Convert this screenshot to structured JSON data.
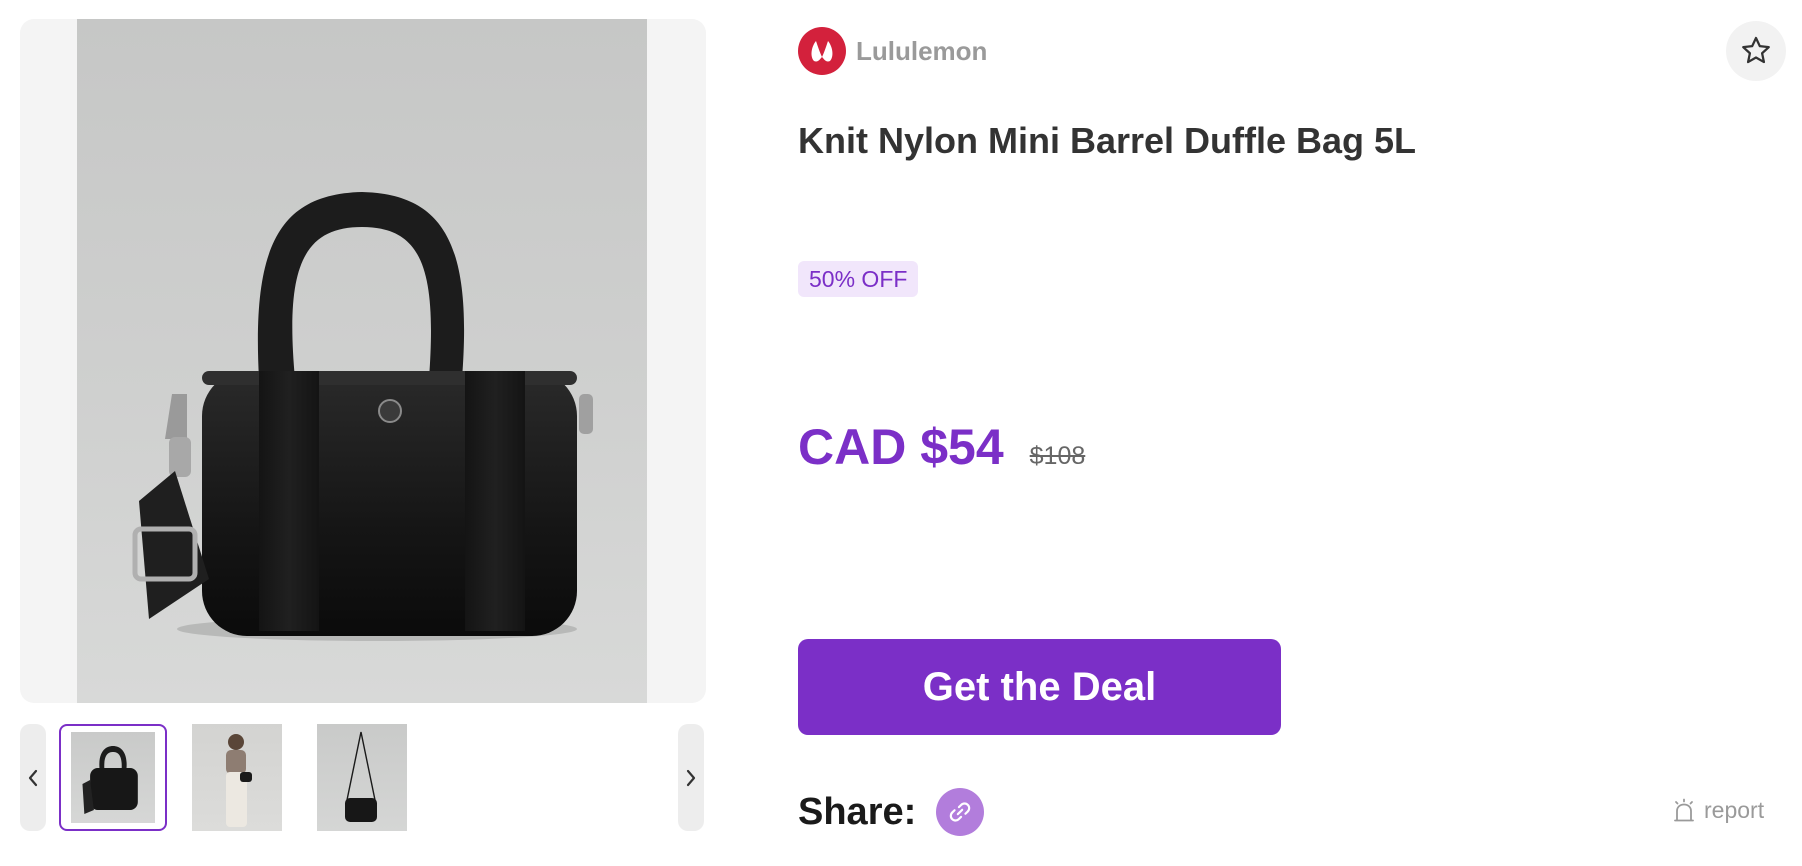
{
  "product": {
    "brand": "Lululemon",
    "title": "Knit Nylon Mini Barrel Duffle Bag 5L",
    "discount_badge": "50% OFF",
    "price_current": "CAD $54",
    "price_original": "$108"
  },
  "actions": {
    "deal_button_label": "Get the Deal",
    "share_label": "Share:",
    "report_label": "report"
  },
  "gallery": {
    "thumbnails": [
      "bag-front",
      "model-wearing-bag",
      "bag-with-long-strap"
    ],
    "selected_index": 0
  },
  "colors": {
    "accent": "#7b2fc7",
    "badge_bg": "#f1e6fb",
    "brand_logo": "#d3213c",
    "share_icon_bg": "#b27ddc"
  },
  "icons": {
    "favorite": "star-icon",
    "share": "link-icon",
    "report": "alarm-icon",
    "prev": "chevron-left-icon",
    "next": "chevron-right-icon"
  }
}
